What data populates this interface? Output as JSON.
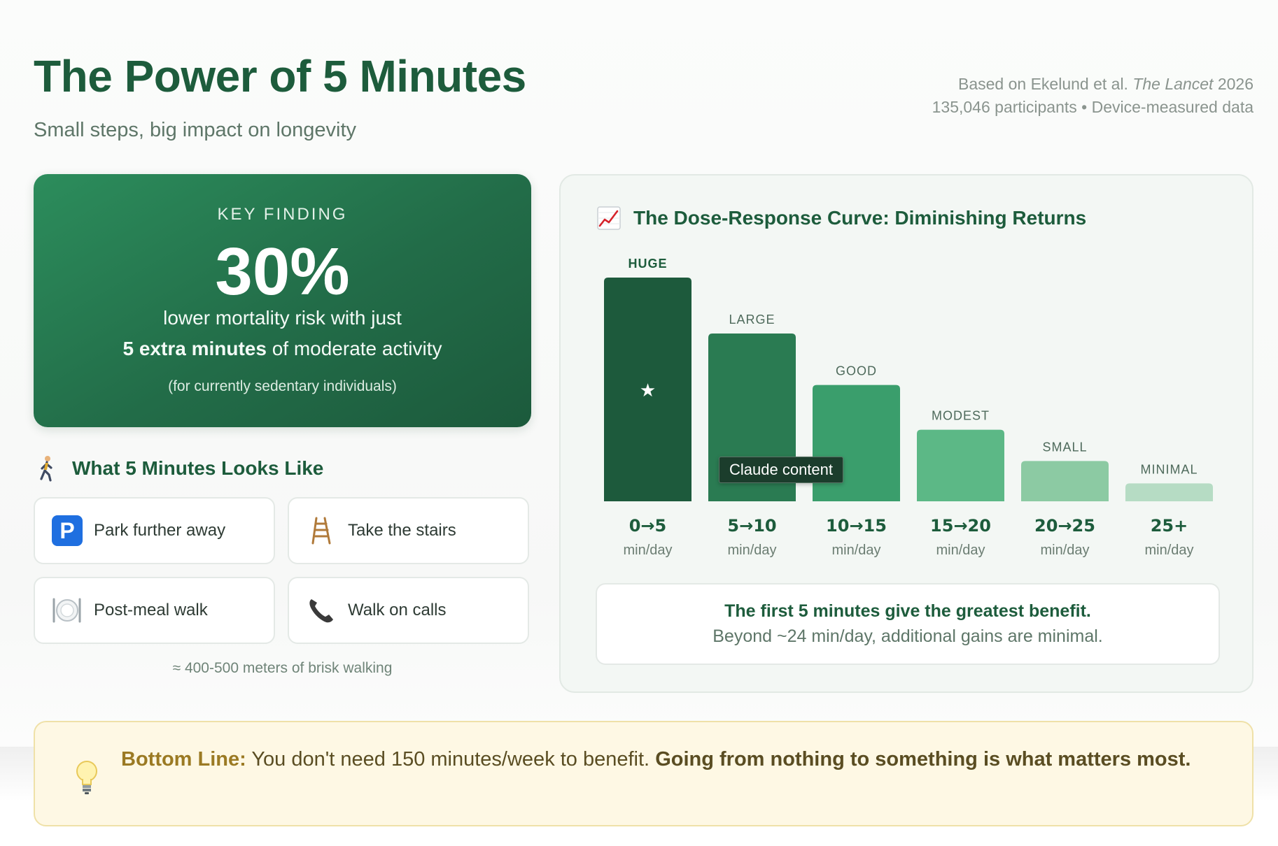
{
  "header": {
    "title": "The Power of 5 Minutes",
    "subtitle": "Small steps, big impact on longevity",
    "source_prefix": "Based on Ekelund et al.",
    "source_journal": "The Lancet",
    "source_year": "2026",
    "source_line2": "135,046 participants • Device-measured data"
  },
  "key_finding": {
    "label": "KEY FINDING",
    "value": "30%",
    "line1": "lower mortality risk with just",
    "line2_bold": "5 extra minutes",
    "line2_rest": " of moderate activity",
    "note": "(for currently sedentary individuals)"
  },
  "examples": {
    "icon": "person-walking-icon",
    "title": "What 5 Minutes Looks Like",
    "items": [
      {
        "label": "Park further away",
        "icon": "parking-icon"
      },
      {
        "label": "Take the stairs",
        "icon": "ladder-icon"
      },
      {
        "label": "Post-meal walk",
        "icon": "plate-icon"
      },
      {
        "label": "Walk on calls",
        "icon": "phone-icon"
      }
    ],
    "note": "≈ 400-500 meters of brisk walking"
  },
  "chart_card": {
    "icon": "chart-increasing-icon",
    "title": "The Dose-Response Curve: Diminishing Returns",
    "tooltip": "Claude content",
    "insight_main": "The first 5 minutes give the greatest benefit.",
    "insight_sub": "Beyond ~24 min/day, additional gains are minimal."
  },
  "chart_data": {
    "type": "bar",
    "title": "The Dose-Response Curve: Diminishing Returns",
    "categories": [
      "0→5",
      "5→10",
      "10→15",
      "15→20",
      "20→25",
      "25+"
    ],
    "unit_label": "min/day",
    "bar_labels": [
      "HUGE",
      "LARGE",
      "GOOD",
      "MODEST",
      "SMALL",
      "MINIMAL"
    ],
    "values": [
      100,
      75,
      52,
      32,
      18,
      8
    ],
    "ylim": [
      0,
      100
    ],
    "highlight_index": 0,
    "highlight_marker": "★",
    "colors": [
      "#1d5a3c",
      "#2a7b52",
      "#3a9e6c",
      "#5cb886",
      "#8ccaa3",
      "#b6dcc4"
    ],
    "grid": false
  },
  "bottom_line": {
    "icon": "light-bulb-icon",
    "lead": "Bottom Line:",
    "text": " You don't need 150 minutes/week to benefit. ",
    "strong": "Going from nothing to something is what matters most."
  },
  "colors": {
    "brand_green": "#1d5c3c",
    "muted_green": "#5e7668",
    "highlight_bg": "#fef8e4",
    "highlight_text": "#9b7a23"
  }
}
